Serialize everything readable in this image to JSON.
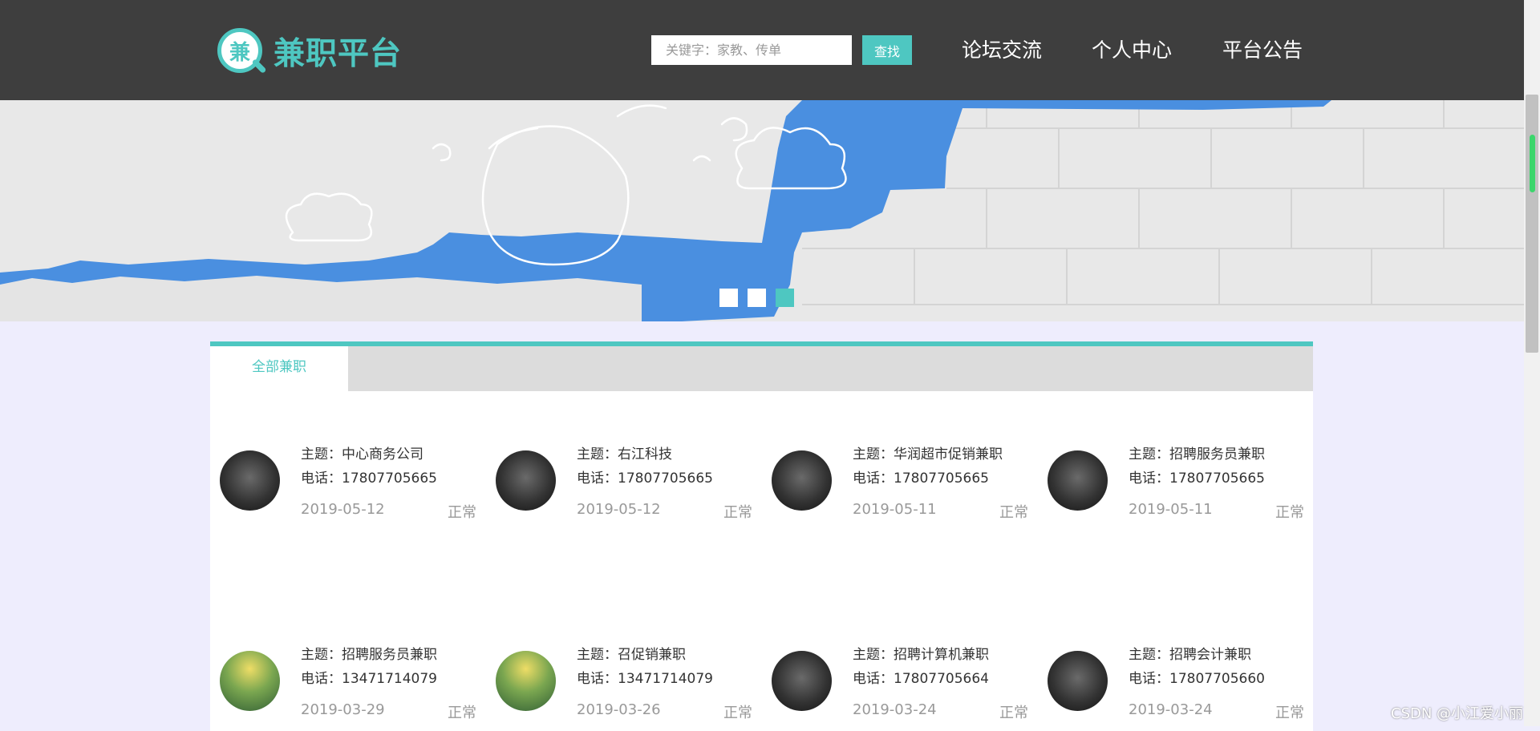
{
  "header": {
    "logo_glyph": "兼",
    "logo_text": "兼职平台",
    "search_placeholder": "关键字：家教、传单",
    "search_button": "查找",
    "nav": [
      "论坛交流",
      "个人中心",
      "平台公告"
    ]
  },
  "banner": {
    "slides": 3,
    "active_slide": 3
  },
  "tabs": {
    "active": "全部兼职"
  },
  "jobs": [
    {
      "topic": "主题：中心商务公司",
      "phone": "电话：17807705665",
      "date": "2019-05-12",
      "status": "正常",
      "avatar": "warrior-avatar"
    },
    {
      "topic": "主题：右江科技",
      "phone": "电话：17807705665",
      "date": "2019-05-12",
      "status": "正常",
      "avatar": "warrior-avatar"
    },
    {
      "topic": "主题：华润超市促销兼职",
      "phone": "电话：17807705665",
      "date": "2019-05-11",
      "status": "正常",
      "avatar": "warrior-avatar"
    },
    {
      "topic": "主题：招聘服务员兼职",
      "phone": "电话：17807705665",
      "date": "2019-05-11",
      "status": "正常",
      "avatar": "warrior-avatar"
    },
    {
      "topic": "主题：招聘服务员兼职",
      "phone": "电话：13471714079",
      "date": "2019-03-29",
      "status": "正常",
      "avatar": "kids-avatar"
    },
    {
      "topic": "主题：召促销兼职",
      "phone": "电话：13471714079",
      "date": "2019-03-26",
      "status": "正常",
      "avatar": "kids-avatar"
    },
    {
      "topic": "主题：招聘计算机兼职",
      "phone": "电话：17807705664",
      "date": "2019-03-24",
      "status": "正常",
      "avatar": "warrior-avatar"
    },
    {
      "topic": "主题：招聘会计兼职",
      "phone": "电话：17807705660",
      "date": "2019-03-24",
      "status": "正常",
      "avatar": "warrior-avatar"
    }
  ],
  "watermark": "CSDN @小江爱小丽",
  "colors": {
    "accent": "#4ec7c1",
    "header_bg": "#3e3e3e",
    "page_bg": "#eeedfd",
    "banner_blue": "#4a8fe0"
  }
}
